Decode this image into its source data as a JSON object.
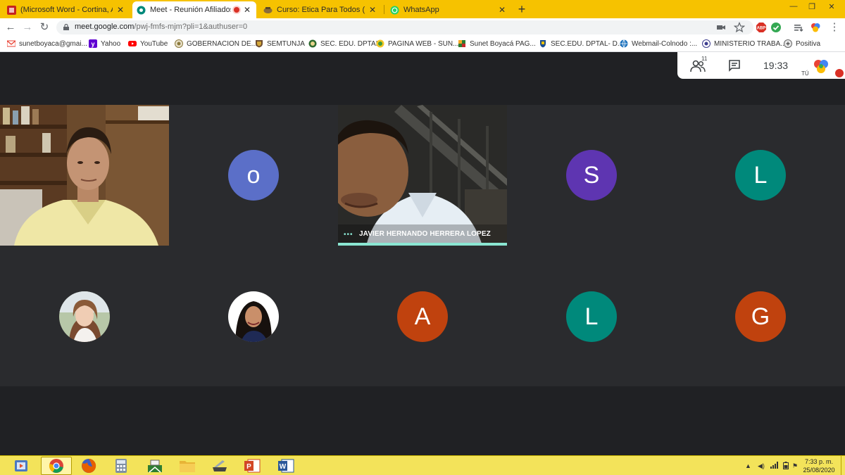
{
  "browser": {
    "tabs": [
      {
        "title": "(Microsoft Word - Cortina, Adela"
      },
      {
        "title": "Meet - Reunión Afiliados Alc",
        "recording": true
      },
      {
        "title": "Curso: Etica Para Todos (Presenc"
      },
      {
        "title": "WhatsApp"
      }
    ],
    "new_tab": "+",
    "url_host": "meet.google.com",
    "url_path": "/pwj-fmfs-mjm?pli=1&authuser=0",
    "ext_abp": "ABP",
    "bookmarks": [
      "sunetboyaca@gmai...",
      "Yahoo",
      "YouTube",
      "GOBERNACION DE...",
      "SEMTUNJA",
      "SEC. EDU. DPTAL",
      "PAGINA WEB - SUN...",
      "Sunet Boyacá  PAG...",
      "SEC.EDU. DPTAL- D...",
      "Webmail-Colnodo :...",
      "MINISTERIO TRABA...",
      "Positiva"
    ]
  },
  "meet": {
    "participant_count": "11",
    "time": "19:33",
    "self_label": "TÚ",
    "speaker_name": "JAVIER HERNANDO HERRERA LOPEZ",
    "speaker_dots": "•••",
    "avatars": [
      {
        "letter": "o",
        "color": "#5b6fc8"
      },
      {
        "letter": "S",
        "color": "#5e35b1"
      },
      {
        "letter": "L",
        "color": "#00897b"
      },
      {
        "letter": "A",
        "color": "#c0420e"
      },
      {
        "letter": "L",
        "color": "#00897b"
      },
      {
        "letter": "G",
        "color": "#c0420e"
      }
    ]
  },
  "taskbar": {
    "clock_time": "7:33 p. m.",
    "clock_date": "25/08/2020"
  },
  "colors": {
    "tabstrip": "#f6c200",
    "meet_bg": "#202124",
    "speaker_accent": "#8ae6d2",
    "taskbar": "#f3e35a"
  }
}
